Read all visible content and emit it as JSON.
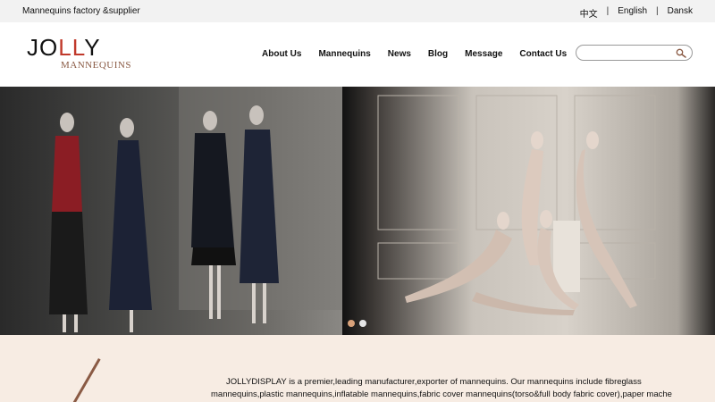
{
  "topbar": {
    "tagline": "Mannequins factory &supplier",
    "languages": [
      "中文",
      "English",
      "Dansk"
    ],
    "separator": "|"
  },
  "logo": {
    "main_j": "J",
    "main_o": "O",
    "main_ll": "LL",
    "main_y": "Y",
    "sub": "MANNEQUINS"
  },
  "nav": {
    "items": [
      "About Us",
      "Mannequins",
      "News",
      "Blog",
      "Message",
      "Contact Us"
    ]
  },
  "search": {
    "placeholder": "",
    "value": ""
  },
  "banner": {
    "active_slide": 1,
    "slide_count": 2,
    "dot_active_color": "#d9a27a",
    "dot_inactive_color": "#e6e6e6"
  },
  "intro": {
    "text": "JOLLYDISPLAY is a premier,leading manufacturer,exporter of mannequins. Our mannequins include fibreglass mannequins,plastic mannequins,inflatable mannequins,fabric cover mannequins(torso&full body fabric cover),paper mache mannequins. All our"
  },
  "colors": {
    "logo_accent": "#c0392b",
    "logo_sub": "#8a5a44",
    "intro_bg": "#f7ece3"
  }
}
